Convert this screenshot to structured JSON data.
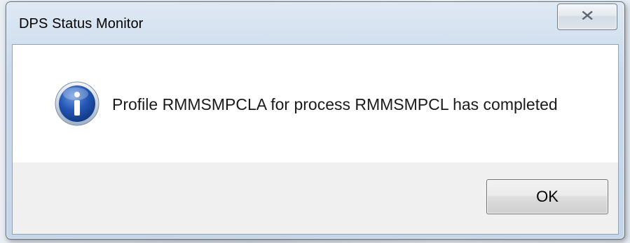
{
  "window": {
    "title": "DPS Status Monitor",
    "close_icon": "close-icon"
  },
  "dialog": {
    "icon": "information-icon",
    "message": "Profile RMMSMPCLA for process RMMSMPCL has completed",
    "ok_label": "OK"
  },
  "colors": {
    "titlebar": "#c9d9ea",
    "info_icon_blue": "#1f4fa8",
    "button_area": "#f0f0f0"
  }
}
